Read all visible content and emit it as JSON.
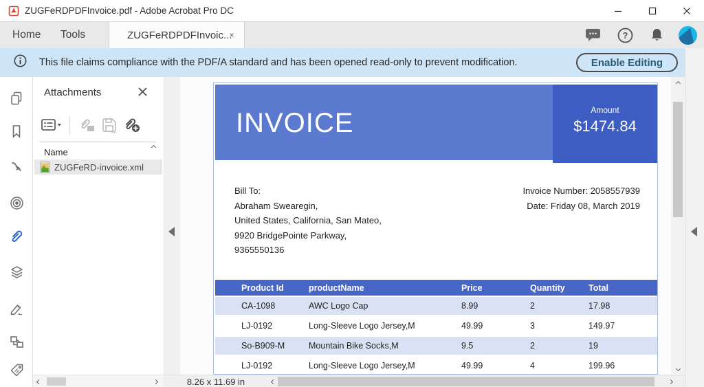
{
  "window": {
    "title": "ZUGFeRDPDFInvoice.pdf - Adobe Acrobat Pro DC"
  },
  "tab_bar": {
    "home": "Home",
    "tools": "Tools",
    "document_tab": "ZUGFeRDPDFInvoic...",
    "document_tab_close": "×"
  },
  "notification_bar": {
    "message": "This file claims compliance with the PDF/A standard and has been opened read-only to prevent modification.",
    "enable_editing_button": "Enable Editing"
  },
  "sidebar": {
    "icons": [
      "page-thumbnails",
      "bookmarks",
      "destinations",
      "articles",
      "attachments",
      "layers",
      "signatures",
      "order",
      "tags"
    ],
    "active": "attachments"
  },
  "attachments_panel": {
    "title": "Attachments",
    "name_header": "Name",
    "files": [
      {
        "name": "ZUGFeRD-invoice.xml"
      }
    ]
  },
  "document": {
    "invoice": {
      "title": "INVOICE",
      "amount_label": "Amount",
      "amount_value": "$1474.84",
      "bill_to_label": "Bill To:",
      "bill_to_lines": [
        "Abraham Swearegin,",
        "United States, California, San Mateo,",
        "9920 BridgePointe Parkway,",
        "9365550136"
      ],
      "invoice_number": "Invoice Number: 2058557939",
      "date": "Date: Friday 08, March 2019",
      "table": {
        "headers": [
          "Product Id",
          "productName",
          "Price",
          "Quantity",
          "Total"
        ],
        "rows": [
          [
            "CA-1098",
            "AWC Logo Cap",
            "8.99",
            "2",
            "17.98"
          ],
          [
            "LJ-0192",
            "Long-Sleeve Logo Jersey,M",
            "49.99",
            "3",
            "149.97"
          ],
          [
            "So-B909-M",
            "Mountain Bike Socks,M",
            "9.5",
            "2",
            "19"
          ],
          [
            "LJ-0192",
            "Long-Sleeve Logo Jersey,M",
            "49.99",
            "4",
            "199.96"
          ]
        ]
      }
    }
  },
  "status_bar": {
    "page_size": "8.26 x 11.69 in"
  },
  "colors": {
    "banner_blue": "#5b79ce",
    "amount_box_blue": "#3d5dc3",
    "table_header_blue": "#4866c5",
    "table_alt_row": "#d9e2f4",
    "notification_bg": "#cde5f7",
    "active_tool_blue": "#2a66c4",
    "avatar_cyan": "#1ab6e8"
  }
}
